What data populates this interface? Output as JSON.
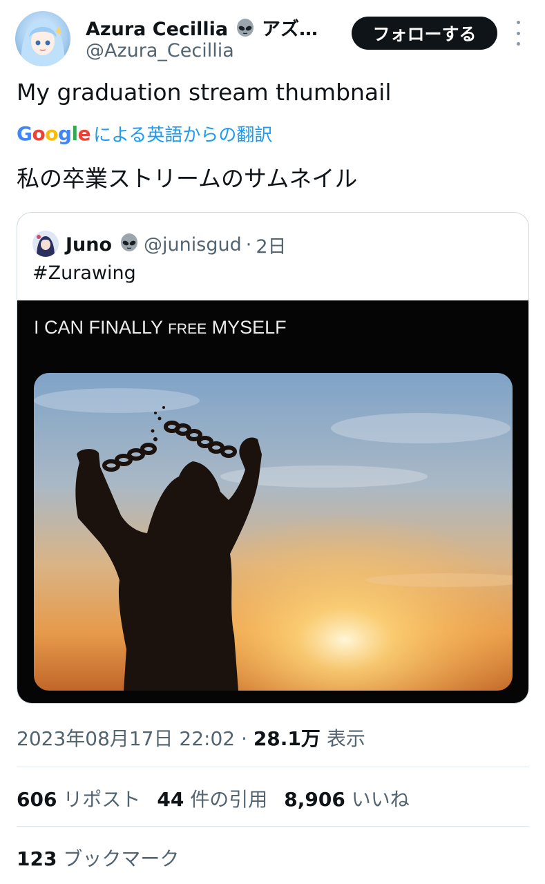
{
  "author": {
    "display_name": "Azura Cecillia",
    "display_name_suffix": "アズ…",
    "handle": "@Azura_Cecillia",
    "badge_icon": "alien-emoji-icon"
  },
  "follow_button_label": "フォローする",
  "tweet": {
    "text": "My graduation stream thumbnail",
    "translation_prefix": "Google",
    "translation_label": "による英語からの翻訳",
    "translated_text": "私の卒業ストリームのサムネイル"
  },
  "quote": {
    "name": "Juno",
    "handle": "@junisgud",
    "separator": "·",
    "age": "2日",
    "text": "#Zurawing",
    "media_caption_part1": "I CAN FINALLY",
    "media_caption_part2": "FREE",
    "media_caption_part3": "MYSELF"
  },
  "meta": {
    "timestamp": "2023年08月17日 22:02",
    "separator": "·",
    "views_count": "28.1万",
    "views_label": "表示"
  },
  "stats": {
    "reposts_count": "606",
    "reposts_label": "リポスト",
    "quotes_count": "44",
    "quotes_label": "件の引用",
    "likes_count": "8,906",
    "likes_label": "いいね",
    "bookmarks_count": "123",
    "bookmarks_label": "ブックマーク"
  },
  "colors": {
    "link_blue": "#1d9bf0",
    "secondary_text": "#536471",
    "primary_text": "#0f1419",
    "google_blue": "#4285f4",
    "google_red": "#ea4335",
    "google_yellow": "#fbbc05",
    "google_green": "#34a853"
  }
}
